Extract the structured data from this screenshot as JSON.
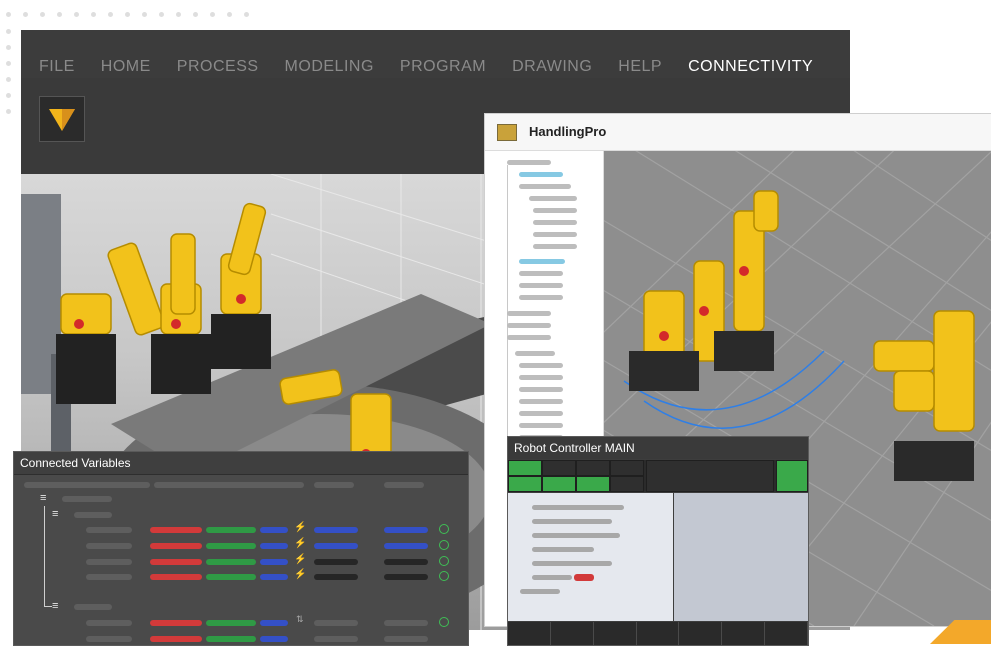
{
  "menu": {
    "items": [
      "FILE",
      "HOME",
      "PROCESS",
      "MODELING",
      "PROGRAM",
      "DRAWING",
      "HELP",
      "CONNECTIVITY"
    ],
    "active": "CONNECTIVITY"
  },
  "handling_pro": {
    "title": "HandlingPro"
  },
  "connected_variables": {
    "title": "Connected Variables"
  },
  "robot_controller": {
    "title": "Robot Controller  MAIN"
  },
  "colors": {
    "brand_yellow": "#f2b51b",
    "status_green": "#3fbf55",
    "signal_red": "#d23a3a",
    "signal_green": "#2f9a45",
    "signal_blue": "#3450c7",
    "tree_selected": "#86c9e3"
  },
  "icons": {
    "logo": "vendor-v-logo-icon",
    "app": "handlingpro-app-icon",
    "status": "check-circle-icon",
    "power": "lightning-icon"
  }
}
